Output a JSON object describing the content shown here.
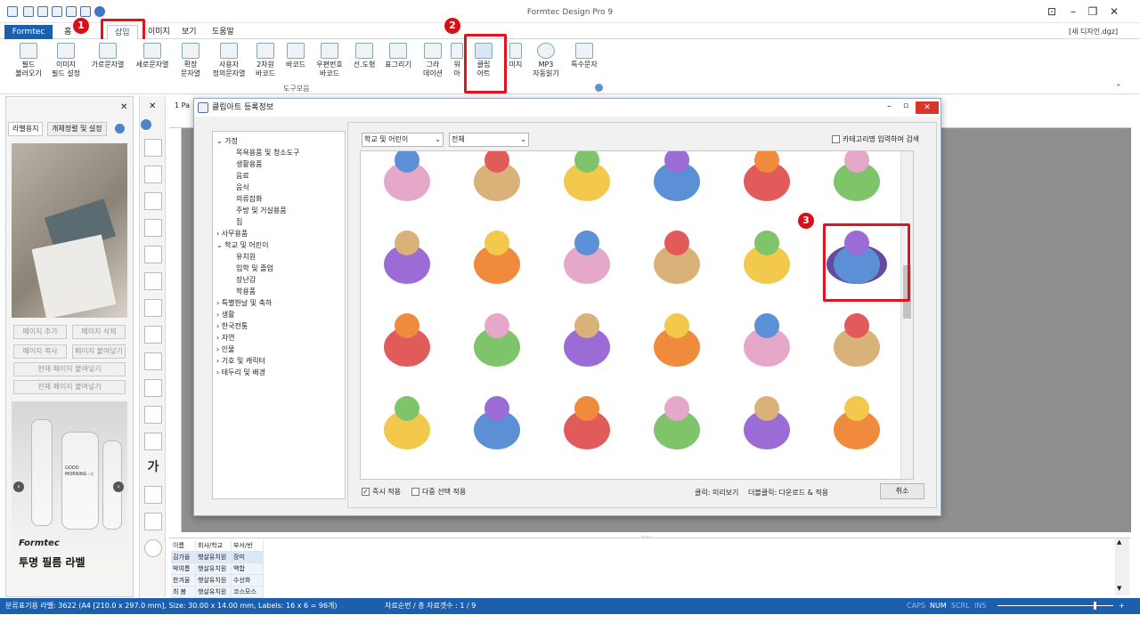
{
  "window": {
    "title": "Formtec Design Pro 9",
    "doc_name": "[새 디자인.dgz]"
  },
  "tabs": [
    {
      "label": "Formtec"
    },
    {
      "label": "홈"
    },
    {
      "label": "삽입"
    },
    {
      "label": "이미지"
    },
    {
      "label": "보기"
    },
    {
      "label": "도움말"
    }
  ],
  "ribbon": {
    "items": [
      {
        "label": "필드\n불러오기"
      },
      {
        "label": "이미지\n필드 설정"
      },
      {
        "label": "가로문자열"
      },
      {
        "label": "세로문자열"
      },
      {
        "label": "확장\n문자열"
      },
      {
        "label": "사용자\n정의문자열"
      },
      {
        "label": "2차원\n바코드"
      },
      {
        "label": "바코드"
      },
      {
        "label": "우편번호\n바코드"
      },
      {
        "label": "선.도형"
      },
      {
        "label": "표그리기"
      },
      {
        "label": "그라\n데이션"
      },
      {
        "label": "워\n아"
      },
      {
        "label": "클립\n아트"
      },
      {
        "label": "미지"
      },
      {
        "label": "MP3\n자동읽기"
      },
      {
        "label": "특수문자"
      }
    ],
    "group_label": "도구모음"
  },
  "badges": {
    "b1": "1",
    "b2": "2",
    "b3": "3"
  },
  "left_panel": {
    "tabs": [
      "라벨용지",
      "개체정렬 및 설정"
    ],
    "buttons": [
      "페이지 추가",
      "페이지 삭제",
      "페이지 복사",
      "페이지 붙여넣기",
      "현재 페이지 붙여넣기",
      "전체 페이지 붙여넣기"
    ],
    "promo_brand": "Formtec",
    "promo_text": "투명 필름 라벨",
    "bottle_text": "GOOD MORNING :-)"
  },
  "canvas": {
    "page_tab": "1 Pa"
  },
  "dialog": {
    "title": "클립아트 등록정보",
    "tree": [
      {
        "label": "가정",
        "level": 0,
        "expanded": true
      },
      {
        "label": "목욕용품 및 청소도구",
        "level": 1
      },
      {
        "label": "생활용품",
        "level": 1
      },
      {
        "label": "음료",
        "level": 1
      },
      {
        "label": "음식",
        "level": 1
      },
      {
        "label": "의류잡화",
        "level": 1
      },
      {
        "label": "주방 및 거실용품",
        "level": 1
      },
      {
        "label": "집",
        "level": 1
      },
      {
        "label": "사무용품",
        "level": 0,
        "expanded": false
      },
      {
        "label": "학교 및 어린이",
        "level": 0,
        "expanded": true
      },
      {
        "label": "유치원",
        "level": 1
      },
      {
        "label": "입학 및 졸업",
        "level": 1
      },
      {
        "label": "장난감",
        "level": 1
      },
      {
        "label": "학용품",
        "level": 1
      },
      {
        "label": "특별한날 및 축하",
        "level": 0,
        "expanded": false
      },
      {
        "label": "생활",
        "level": 0,
        "expanded": false
      },
      {
        "label": "한국전통",
        "level": 0,
        "expanded": false
      },
      {
        "label": "자연",
        "level": 0,
        "expanded": false
      },
      {
        "label": "인물",
        "level": 0,
        "expanded": false
      },
      {
        "label": "기호 및 캐릭터",
        "level": 0,
        "expanded": false
      },
      {
        "label": "테두리 및 배경",
        "level": 0,
        "expanded": false
      }
    ],
    "category_select": "학교 및 어린이",
    "sub_select": "전체",
    "search_checkbox": "카테고리명 입력하여 검색",
    "clipart": [
      [
        "teddy-cake",
        "pink-bear",
        "teddy-sitting",
        "cream-bear",
        "plush-bear",
        "swing"
      ],
      [
        "toy-train",
        "puppet",
        "baby-rattle",
        "duck-float",
        "robot-sword",
        "rocket-badge"
      ],
      [
        "rocket-cloud",
        "drum-stick",
        "toy-giraffe",
        "slide-blue",
        "slide-elephant",
        "pinwheel"
      ],
      [
        "pinwheel-hand",
        "airplane",
        "clown-doll",
        "jack-box",
        "bird-box",
        "clown-hat"
      ]
    ],
    "apply_now": "즉시 적용",
    "multi_select": "다중 선택 적용",
    "hint_click": "클릭: 미리보기",
    "hint_dbl": "더블클릭: 다운로드 & 적용",
    "cancel": "취소"
  },
  "grid": {
    "headers": [
      "이름",
      "회사/학교",
      "부서/반"
    ],
    "rows": [
      [
        "김가을",
        "햇살유치원",
        "장미"
      ],
      [
        "박여름",
        "햇살유치원",
        "백합"
      ],
      [
        "한겨울",
        "햇살유치원",
        "수선화"
      ],
      [
        "최 봄",
        "햇살유치원",
        "코스모스"
      ]
    ]
  },
  "status": {
    "left": "분류표기용 라벨: 3622 (A4 [210.0 x 297.0 mm], Size: 30.00 x 14.00 mm,  Labels: 16 x 6 = 96개)",
    "middle": "자료순번 / 총 자료갯수 : 1 / 9",
    "caps": "CAPS",
    "num": "NUM",
    "scrl": "SCRL",
    "ins": "INS"
  }
}
